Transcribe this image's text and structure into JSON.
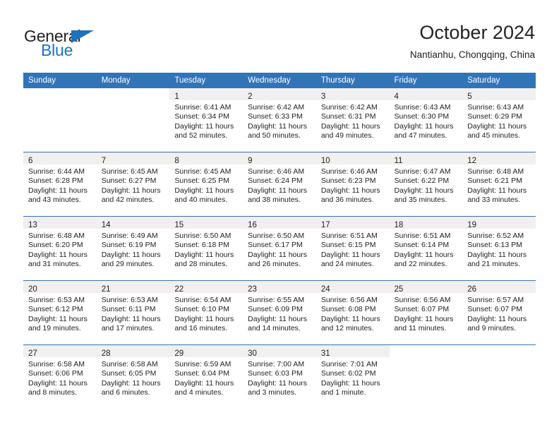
{
  "logo": {
    "word_one": "General",
    "word_two": "Blue",
    "triangle_color": "#1f72bd",
    "text_color": "#231f20"
  },
  "header": {
    "title": "October 2024",
    "subtitle": "Nantianhu, Chongqing, China"
  },
  "theme": {
    "header_bg": "#3274b8",
    "daynum_band_bg": "#f0f0f0",
    "grid_line": "#3274b8",
    "text": "#222222"
  },
  "weekday_headers": [
    "Sunday",
    "Monday",
    "Tuesday",
    "Wednesday",
    "Thursday",
    "Friday",
    "Saturday"
  ],
  "weeks": [
    [
      {
        "day": "",
        "sunrise": "",
        "sunset": "",
        "daylight_line1": "",
        "daylight_line2": ""
      },
      {
        "day": "",
        "sunrise": "",
        "sunset": "",
        "daylight_line1": "",
        "daylight_line2": ""
      },
      {
        "day": "1",
        "sunrise": "Sunrise: 6:41 AM",
        "sunset": "Sunset: 6:34 PM",
        "daylight_line1": "Daylight: 11 hours",
        "daylight_line2": "and 52 minutes."
      },
      {
        "day": "2",
        "sunrise": "Sunrise: 6:42 AM",
        "sunset": "Sunset: 6:33 PM",
        "daylight_line1": "Daylight: 11 hours",
        "daylight_line2": "and 50 minutes."
      },
      {
        "day": "3",
        "sunrise": "Sunrise: 6:42 AM",
        "sunset": "Sunset: 6:31 PM",
        "daylight_line1": "Daylight: 11 hours",
        "daylight_line2": "and 49 minutes."
      },
      {
        "day": "4",
        "sunrise": "Sunrise: 6:43 AM",
        "sunset": "Sunset: 6:30 PM",
        "daylight_line1": "Daylight: 11 hours",
        "daylight_line2": "and 47 minutes."
      },
      {
        "day": "5",
        "sunrise": "Sunrise: 6:43 AM",
        "sunset": "Sunset: 6:29 PM",
        "daylight_line1": "Daylight: 11 hours",
        "daylight_line2": "and 45 minutes."
      }
    ],
    [
      {
        "day": "6",
        "sunrise": "Sunrise: 6:44 AM",
        "sunset": "Sunset: 6:28 PM",
        "daylight_line1": "Daylight: 11 hours",
        "daylight_line2": "and 43 minutes."
      },
      {
        "day": "7",
        "sunrise": "Sunrise: 6:45 AM",
        "sunset": "Sunset: 6:27 PM",
        "daylight_line1": "Daylight: 11 hours",
        "daylight_line2": "and 42 minutes."
      },
      {
        "day": "8",
        "sunrise": "Sunrise: 6:45 AM",
        "sunset": "Sunset: 6:25 PM",
        "daylight_line1": "Daylight: 11 hours",
        "daylight_line2": "and 40 minutes."
      },
      {
        "day": "9",
        "sunrise": "Sunrise: 6:46 AM",
        "sunset": "Sunset: 6:24 PM",
        "daylight_line1": "Daylight: 11 hours",
        "daylight_line2": "and 38 minutes."
      },
      {
        "day": "10",
        "sunrise": "Sunrise: 6:46 AM",
        "sunset": "Sunset: 6:23 PM",
        "daylight_line1": "Daylight: 11 hours",
        "daylight_line2": "and 36 minutes."
      },
      {
        "day": "11",
        "sunrise": "Sunrise: 6:47 AM",
        "sunset": "Sunset: 6:22 PM",
        "daylight_line1": "Daylight: 11 hours",
        "daylight_line2": "and 35 minutes."
      },
      {
        "day": "12",
        "sunrise": "Sunrise: 6:48 AM",
        "sunset": "Sunset: 6:21 PM",
        "daylight_line1": "Daylight: 11 hours",
        "daylight_line2": "and 33 minutes."
      }
    ],
    [
      {
        "day": "13",
        "sunrise": "Sunrise: 6:48 AM",
        "sunset": "Sunset: 6:20 PM",
        "daylight_line1": "Daylight: 11 hours",
        "daylight_line2": "and 31 minutes."
      },
      {
        "day": "14",
        "sunrise": "Sunrise: 6:49 AM",
        "sunset": "Sunset: 6:19 PM",
        "daylight_line1": "Daylight: 11 hours",
        "daylight_line2": "and 29 minutes."
      },
      {
        "day": "15",
        "sunrise": "Sunrise: 6:50 AM",
        "sunset": "Sunset: 6:18 PM",
        "daylight_line1": "Daylight: 11 hours",
        "daylight_line2": "and 28 minutes."
      },
      {
        "day": "16",
        "sunrise": "Sunrise: 6:50 AM",
        "sunset": "Sunset: 6:17 PM",
        "daylight_line1": "Daylight: 11 hours",
        "daylight_line2": "and 26 minutes."
      },
      {
        "day": "17",
        "sunrise": "Sunrise: 6:51 AM",
        "sunset": "Sunset: 6:15 PM",
        "daylight_line1": "Daylight: 11 hours",
        "daylight_line2": "and 24 minutes."
      },
      {
        "day": "18",
        "sunrise": "Sunrise: 6:51 AM",
        "sunset": "Sunset: 6:14 PM",
        "daylight_line1": "Daylight: 11 hours",
        "daylight_line2": "and 22 minutes."
      },
      {
        "day": "19",
        "sunrise": "Sunrise: 6:52 AM",
        "sunset": "Sunset: 6:13 PM",
        "daylight_line1": "Daylight: 11 hours",
        "daylight_line2": "and 21 minutes."
      }
    ],
    [
      {
        "day": "20",
        "sunrise": "Sunrise: 6:53 AM",
        "sunset": "Sunset: 6:12 PM",
        "daylight_line1": "Daylight: 11 hours",
        "daylight_line2": "and 19 minutes."
      },
      {
        "day": "21",
        "sunrise": "Sunrise: 6:53 AM",
        "sunset": "Sunset: 6:11 PM",
        "daylight_line1": "Daylight: 11 hours",
        "daylight_line2": "and 17 minutes."
      },
      {
        "day": "22",
        "sunrise": "Sunrise: 6:54 AM",
        "sunset": "Sunset: 6:10 PM",
        "daylight_line1": "Daylight: 11 hours",
        "daylight_line2": "and 16 minutes."
      },
      {
        "day": "23",
        "sunrise": "Sunrise: 6:55 AM",
        "sunset": "Sunset: 6:09 PM",
        "daylight_line1": "Daylight: 11 hours",
        "daylight_line2": "and 14 minutes."
      },
      {
        "day": "24",
        "sunrise": "Sunrise: 6:56 AM",
        "sunset": "Sunset: 6:08 PM",
        "daylight_line1": "Daylight: 11 hours",
        "daylight_line2": "and 12 minutes."
      },
      {
        "day": "25",
        "sunrise": "Sunrise: 6:56 AM",
        "sunset": "Sunset: 6:07 PM",
        "daylight_line1": "Daylight: 11 hours",
        "daylight_line2": "and 11 minutes."
      },
      {
        "day": "26",
        "sunrise": "Sunrise: 6:57 AM",
        "sunset": "Sunset: 6:07 PM",
        "daylight_line1": "Daylight: 11 hours",
        "daylight_line2": "and 9 minutes."
      }
    ],
    [
      {
        "day": "27",
        "sunrise": "Sunrise: 6:58 AM",
        "sunset": "Sunset: 6:06 PM",
        "daylight_line1": "Daylight: 11 hours",
        "daylight_line2": "and 8 minutes."
      },
      {
        "day": "28",
        "sunrise": "Sunrise: 6:58 AM",
        "sunset": "Sunset: 6:05 PM",
        "daylight_line1": "Daylight: 11 hours",
        "daylight_line2": "and 6 minutes."
      },
      {
        "day": "29",
        "sunrise": "Sunrise: 6:59 AM",
        "sunset": "Sunset: 6:04 PM",
        "daylight_line1": "Daylight: 11 hours",
        "daylight_line2": "and 4 minutes."
      },
      {
        "day": "30",
        "sunrise": "Sunrise: 7:00 AM",
        "sunset": "Sunset: 6:03 PM",
        "daylight_line1": "Daylight: 11 hours",
        "daylight_line2": "and 3 minutes."
      },
      {
        "day": "31",
        "sunrise": "Sunrise: 7:01 AM",
        "sunset": "Sunset: 6:02 PM",
        "daylight_line1": "Daylight: 11 hours",
        "daylight_line2": "and 1 minute."
      },
      {
        "day": "",
        "sunrise": "",
        "sunset": "",
        "daylight_line1": "",
        "daylight_line2": ""
      },
      {
        "day": "",
        "sunrise": "",
        "sunset": "",
        "daylight_line1": "",
        "daylight_line2": ""
      }
    ]
  ]
}
